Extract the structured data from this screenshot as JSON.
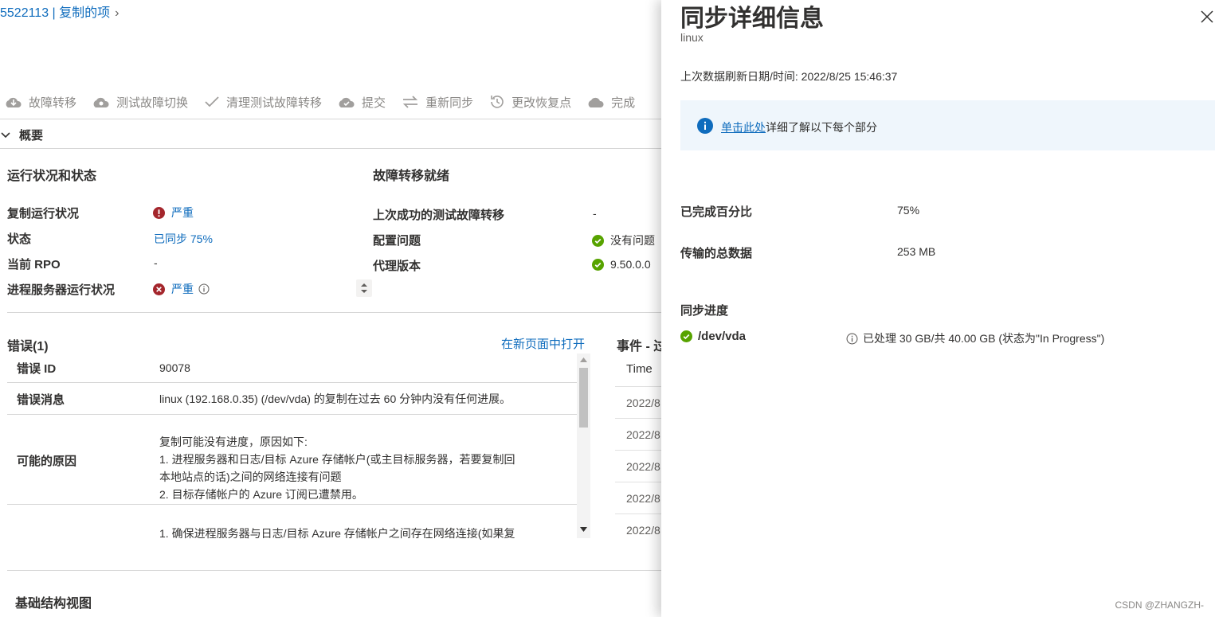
{
  "breadcrumb": {
    "text": "5522113 | 复制的项",
    "chevron": "›"
  },
  "toolbar": [
    {
      "icon": "cloud-failover-icon",
      "label": "故障转移"
    },
    {
      "icon": "cloud-test-icon",
      "label": "测试故障切换"
    },
    {
      "icon": "check-icon",
      "label": "清理测试故障转移"
    },
    {
      "icon": "cloud-commit-icon",
      "label": "提交"
    },
    {
      "icon": "resync-icon",
      "label": "重新同步"
    },
    {
      "icon": "history-icon",
      "label": "更改恢复点"
    },
    {
      "icon": "cloud-complete-icon",
      "label": "完成"
    }
  ],
  "overview": {
    "label": "概要"
  },
  "health": {
    "title": "运行状况和状态",
    "rows": [
      {
        "label": "复制运行状况",
        "value": "严重",
        "status": "error-exclamation"
      },
      {
        "label": "状态",
        "value": "已同步 75%",
        "status": "link"
      },
      {
        "label": "当前 RPO",
        "value": "-",
        "status": "plain"
      },
      {
        "label": "进程服务器运行状况",
        "value": "严重",
        "status": "error-x"
      }
    ]
  },
  "failover": {
    "title": "故障转移就绪",
    "rows": [
      {
        "label": "上次成功的测试故障转移",
        "value": "-",
        "status": "plain"
      },
      {
        "label": "配置问题",
        "value": "没有问题",
        "status": "ok"
      },
      {
        "label": "代理版本",
        "value": "9.50.0.0",
        "status": "ok"
      }
    ]
  },
  "errors": {
    "title": "错误(1)",
    "open_link": "在新页面中打开",
    "rows": [
      {
        "key": "错误 ID",
        "value": "90078"
      },
      {
        "key": "错误消息",
        "value": "linux (192.168.0.35) (/dev/vda) 的复制在过去 60 分钟内没有任何进展。"
      },
      {
        "key": "可能的原因",
        "lines": [
          "复制可能没有进度，原因如下:",
          "1. 进程服务器和日志/目标 Azure 存储帐户(或主目标服务器，若要复制回",
          "本地站点的话)之间的网络连接有问题",
          "2. 目标存储帐户的 Azure 订阅已遭禁用。"
        ]
      },
      {
        "key": "",
        "value": "1. 确保进程服务器与日志/目标 Azure 存储帐户之间存在网络连接(如果复"
      }
    ]
  },
  "events": {
    "title": "事件 - 过",
    "header": "Time",
    "rows": [
      "2022/8",
      "2022/8",
      "2022/8",
      "2022/8",
      "2022/8"
    ]
  },
  "infrastructure": {
    "title": "基础结构视图"
  },
  "panel": {
    "title": "同步详细信息",
    "subtitle": "linux",
    "refresh": "上次数据刷新日期/时间: 2022/8/25 15:46:37",
    "info_link": "单击此处",
    "info_text": "详细了解以下每个部分",
    "percent_label": "已完成百分比",
    "percent_value": "75%",
    "transfer_label": "传输的总数据",
    "transfer_value": "253 MB",
    "progress_title": "同步进度",
    "disk_name": "/dev/vda",
    "disk_status": "已处理 30 GB/共 40.00 GB (状态为\"In Progress\")"
  },
  "watermark": "CSDN @ZHANGZH-",
  "colors": {
    "accent": "#0f6cbd",
    "error": "#a4262c",
    "ok": "#57a300",
    "info": "#0f6cbd"
  }
}
